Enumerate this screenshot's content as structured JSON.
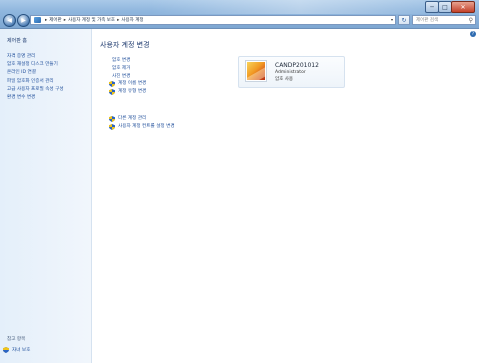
{
  "window": {
    "controls": {
      "minimize": "─",
      "maximize": "□",
      "close": "✕"
    }
  },
  "address_bar": {
    "segments": [
      "제어판",
      "사용자 계정 및 가족 보호",
      "사용자 계정"
    ],
    "separator": "▸",
    "refresh_symbol": "↻",
    "dropdown_symbol": "▾"
  },
  "search": {
    "placeholder": "제어판 검색"
  },
  "left_pane": {
    "home": "제어판 홈",
    "links": [
      "자격 증명 관리",
      "암호 재설정 디스크 만들기",
      "온라인 ID 연결",
      "파일 암호화 인증서 관리",
      "고급 사용자 프로필 속성 구성",
      "환경 변수 변경"
    ],
    "see_also": "참고 항목",
    "parental_controls": "자녀 보호"
  },
  "main": {
    "title": "사용자 계정 변경",
    "tasks": [
      {
        "label": "암호 변경",
        "shield": false
      },
      {
        "label": "암호 제거",
        "shield": false
      },
      {
        "label": "사진 변경",
        "shield": false
      },
      {
        "label": "계정 이름 변경",
        "shield": true
      },
      {
        "label": "계정 유형 변경",
        "shield": true
      }
    ],
    "other_tasks": [
      {
        "label": "다른 계정 관리",
        "shield": true
      },
      {
        "label": "사용자 계정 컨트롤 설정 변경",
        "shield": true
      }
    ],
    "help_symbol": "?"
  },
  "user_card": {
    "name": "CANDP201012",
    "role": "Administrator",
    "password_status": "암호 사용"
  },
  "colors": {
    "link": "#1f4e9a",
    "title": "#1e3a6e",
    "left_pane_bg": "#e4effa",
    "titlebar": "#8fb6de"
  }
}
